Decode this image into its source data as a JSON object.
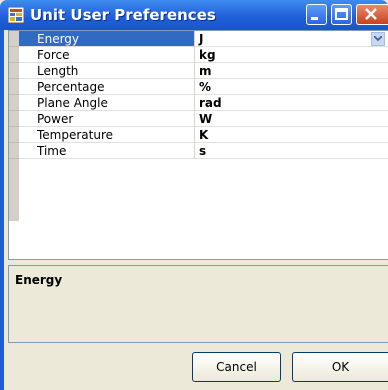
{
  "window": {
    "title": "Unit User Preferences",
    "icons": [
      "app-grid-icon",
      "minimize-icon",
      "maximize-icon",
      "close-icon"
    ]
  },
  "grid": {
    "rows": [
      {
        "name": "Energy",
        "value": "J",
        "selected": true
      },
      {
        "name": "Force",
        "value": "kg"
      },
      {
        "name": "Length",
        "value": "m"
      },
      {
        "name": "Percentage",
        "value": "%"
      },
      {
        "name": "Plane Angle",
        "value": "rad"
      },
      {
        "name": "Power",
        "value": "W"
      },
      {
        "name": "Temperature",
        "value": "K"
      },
      {
        "name": "Time",
        "value": "s"
      }
    ]
  },
  "description": {
    "title": "Energy"
  },
  "buttons": {
    "cancel": "Cancel",
    "ok": "OK"
  },
  "colors": {
    "titlebar": "#1f5fd6",
    "selection": "#316ac5",
    "face": "#ece9d8"
  }
}
